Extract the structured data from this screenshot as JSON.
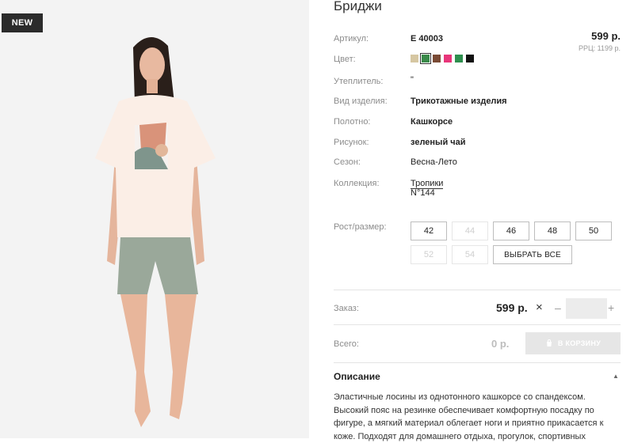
{
  "badge": "NEW",
  "product": {
    "title": "Бриджи",
    "price": "599 р.",
    "rrp": "РРЦ: 1199 р."
  },
  "attributes": {
    "article_label": "Артикул:",
    "article_value": "Е 40003",
    "color_label": "Цвет:",
    "insulation_label": "Утеплитель:",
    "insulation_value": "\"",
    "type_label": "Вид изделия:",
    "type_value": "Трикотажные изделия",
    "fabric_label": "Полотно:",
    "fabric_value": "Кашкорсе",
    "pattern_label": "Рисунок:",
    "pattern_value": "зеленый чай",
    "season_label": "Сезон:",
    "season_value": "Весна-Лето",
    "collection_label": "Коллекция:",
    "collection_value": "Тропики",
    "collection_number": "N°144"
  },
  "colors": [
    "#d6c7a2",
    "#3a8a4a",
    "#7a4b35",
    "#e8357a",
    "#2e8f4e",
    "#111111"
  ],
  "sizes_label": "Рост/размер:",
  "sizes": [
    {
      "label": "42",
      "disabled": false
    },
    {
      "label": "44",
      "disabled": true
    },
    {
      "label": "46",
      "disabled": false
    },
    {
      "label": "48",
      "disabled": false
    },
    {
      "label": "50",
      "disabled": false
    },
    {
      "label": "52",
      "disabled": true
    },
    {
      "label": "54",
      "disabled": true
    }
  ],
  "select_all": "ВЫБРАТЬ ВСЕ",
  "order": {
    "label": "Заказ:",
    "price": "599 р.",
    "times": "×",
    "minus": "–",
    "plus": "+",
    "qty": ""
  },
  "total": {
    "label": "Всего:",
    "value": "0 р.",
    "cart_button": "В КОРЗИНУ"
  },
  "description": {
    "title": "Описание",
    "text": "Эластичные лосины из однотонного кашкорсе со спандексом. Высокий пояс на резинке обеспечивает комфортную посадку по фигуре, а мягкий материал облегает ноги и приятно прикасается к коже. Подходят для домашнего отдыха, прогулок, спортивных"
  }
}
